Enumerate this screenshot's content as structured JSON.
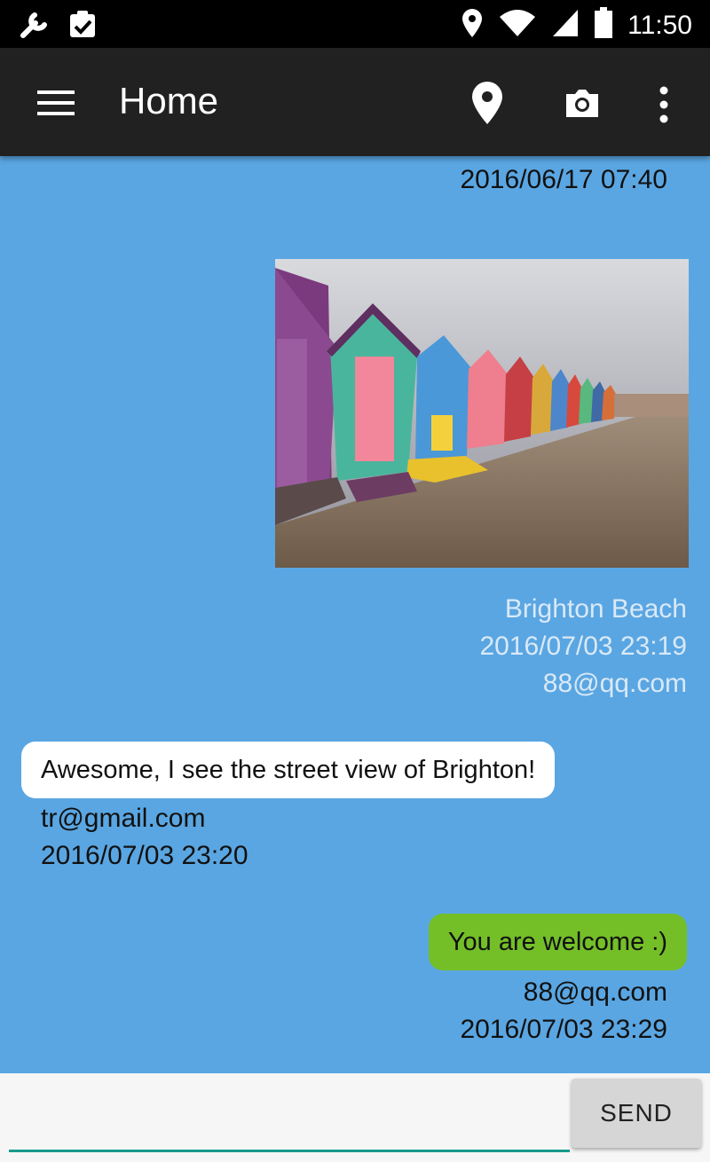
{
  "status_bar": {
    "time": "11:50",
    "icons": [
      "wrench-icon",
      "clipboard-check-icon",
      "location-icon",
      "wifi-icon",
      "signal-icon",
      "battery-icon"
    ]
  },
  "app_bar": {
    "title": "Home",
    "icons": [
      "menu-icon",
      "location-pin-icon",
      "camera-icon",
      "more-vert-icon"
    ]
  },
  "messages": [
    {
      "type": "meta",
      "timestamp": "2016/06/17 07:40"
    },
    {
      "type": "image",
      "caption": "Brighton Beach",
      "timestamp": "2016/07/03 23:19",
      "sender": "88@qq.com"
    },
    {
      "type": "incoming",
      "text": "Awesome, I see the street view of Brighton!",
      "sender": "tr@gmail.com",
      "timestamp": "2016/07/03 23:20"
    },
    {
      "type": "outgoing",
      "text": "You are welcome :)",
      "sender": "88@qq.com",
      "timestamp": "2016/07/03 23:29"
    }
  ],
  "composer": {
    "value": "",
    "placeholder": "",
    "send_label": "SEND"
  },
  "colors": {
    "background": "#5aa6e2",
    "app_bar": "#212121",
    "incoming_bubble": "#ffffff",
    "outgoing_bubble": "#74bf28",
    "input_underline": "#189a8c"
  }
}
